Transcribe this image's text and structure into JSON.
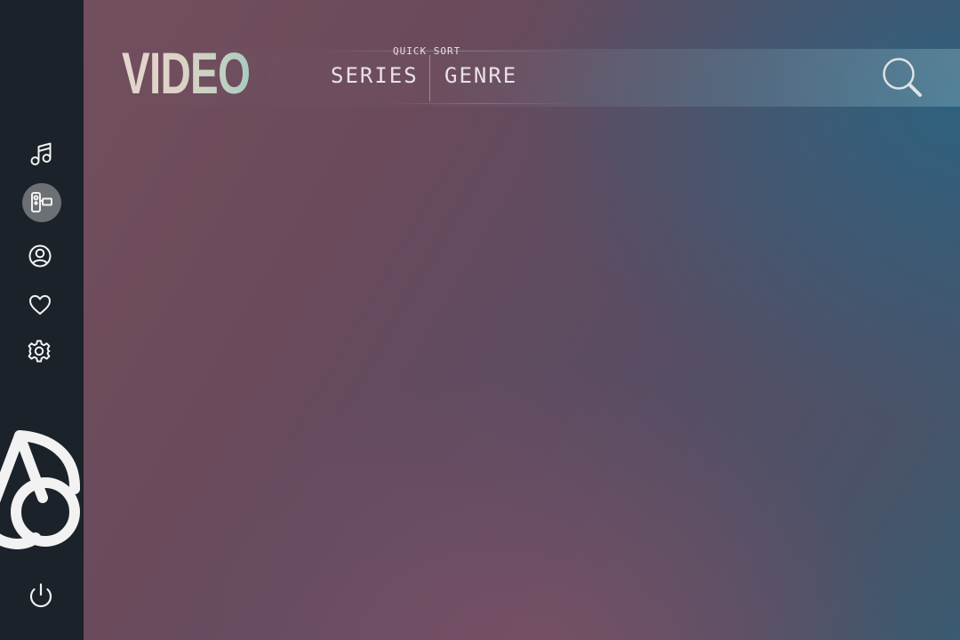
{
  "header": {
    "title": "VIDEO",
    "quick_sort_label": "QUICK SORT",
    "sort_options": [
      "SERIES",
      "GENRE"
    ]
  },
  "sidebar": {
    "items": [
      {
        "icon": "music-note-icon",
        "active": false
      },
      {
        "icon": "video-camera-icon",
        "active": true
      },
      {
        "icon": "user-profile-icon",
        "active": false
      },
      {
        "icon": "heart-icon",
        "active": false
      },
      {
        "icon": "gear-icon",
        "active": false
      }
    ],
    "logo": "app-logo",
    "power": "power-icon"
  },
  "search": {
    "icon": "search-icon"
  },
  "colors": {
    "sidebar_bg": "#1b2229",
    "active_item_bg": "#6c7074",
    "text": "#e9e2e6"
  }
}
